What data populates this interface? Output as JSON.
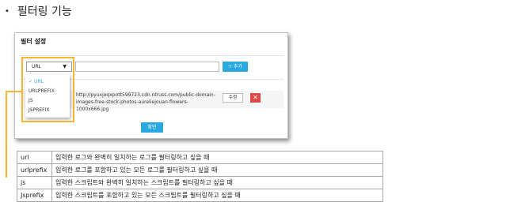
{
  "slide_title": "필터링 기능",
  "slide_bullet": "•",
  "dialog": {
    "title": "필터 설정",
    "type_select": {
      "value": "URL",
      "caret": "▼"
    },
    "add_button": "+ 추가",
    "entry_url": "http://pyuxjoqxpott599723.cdn.ntruss.com/public-domain-images-free-stock-photos-aureliejouan-flowers-1000x666.jpg",
    "edit_button": "수정",
    "delete_button": "✕",
    "confirm_button": "확인"
  },
  "dropdown": {
    "selected_check": "✓",
    "options": [
      "URL",
      "URLPREFIX",
      "JS",
      "JSPREFIX"
    ]
  },
  "table": {
    "rows": [
      {
        "key": "url",
        "desc": "입력한 로그와 완벽히 일치하는 로그를 필터링하고 싶을 때"
      },
      {
        "key": "urlprefix",
        "desc": "입력한 로그를 포함하고 있는 모든 로그를 필터링하고 싶을 때"
      },
      {
        "key": "js",
        "desc": "입력한 스크립트와 완벽히 일치하는 스크립트를 필터링하고 싶을 때"
      },
      {
        "key": "Jsprefix",
        "desc": "입력한 스크립트를 포함하고 있는 모든 스크립트를 필터링하고 싶을 때"
      }
    ]
  },
  "colors": {
    "accent": "#2aa8e0",
    "highlight": "#f5b731",
    "danger": "#e04848"
  }
}
